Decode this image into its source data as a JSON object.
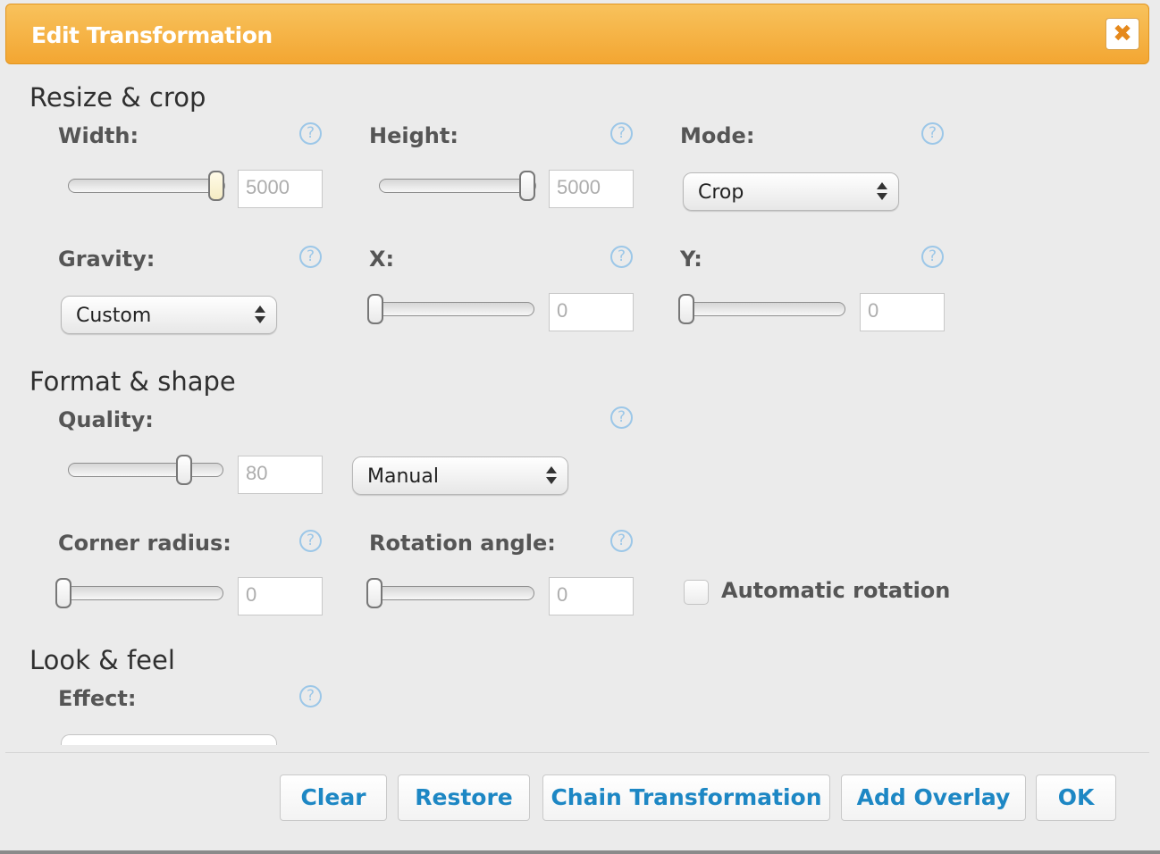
{
  "dialog": {
    "title": "Edit Transformation",
    "close_icon": "close-x-icon",
    "accent_color": "#f3a632",
    "link_color": "#1d87c4"
  },
  "sections": {
    "resize_crop": "Resize & crop",
    "format_shape": "Format & shape",
    "look_feel": "Look & feel"
  },
  "fields": {
    "width": {
      "label": "Width:",
      "value": "5000",
      "slider_level": 1.0
    },
    "height": {
      "label": "Height:",
      "value": "5000",
      "slider_level": 1.0
    },
    "mode": {
      "label": "Mode:",
      "selected": "Crop"
    },
    "gravity": {
      "label": "Gravity:",
      "selected": "Custom"
    },
    "x": {
      "label": "X:",
      "value": "0",
      "slider_level": 0.0
    },
    "y": {
      "label": "Y:",
      "value": "0",
      "slider_level": 0.0
    },
    "quality": {
      "label": "Quality:",
      "value": "80",
      "slider_level": 0.8,
      "selected": "Manual"
    },
    "corner_radius": {
      "label": "Corner radius:",
      "value": "0",
      "slider_level": 0.0
    },
    "rotation_angle": {
      "label": "Rotation angle:",
      "value": "0",
      "slider_level": 0.0
    },
    "automatic_rotation": {
      "label": "Automatic rotation",
      "checked": false
    },
    "effect": {
      "label": "Effect:"
    }
  },
  "help_glyph": "?",
  "buttons": {
    "clear": "Clear",
    "restore": "Restore",
    "chain": "Chain Transformation",
    "add_overlay": "Add Overlay",
    "ok": "OK"
  }
}
